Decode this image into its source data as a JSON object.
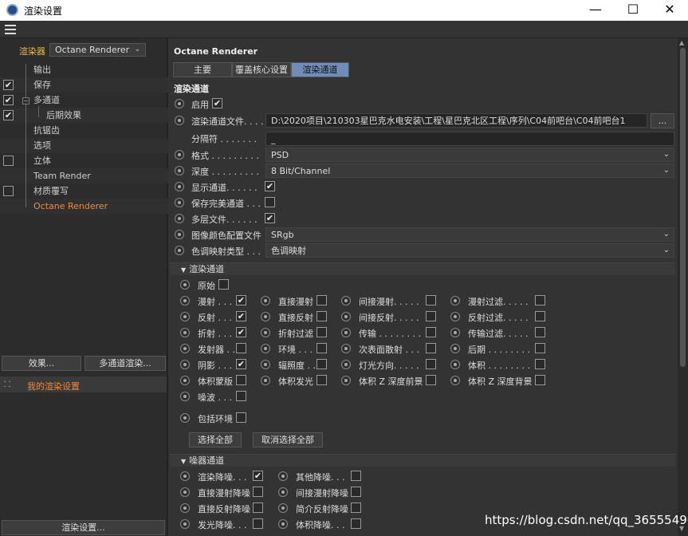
{
  "window": {
    "title": "渲染设置",
    "minimize": "—",
    "maximize": "☐",
    "close": "✕"
  },
  "left": {
    "renderer_label": "渲染器",
    "renderer_value": "Octane Renderer",
    "tree": [
      {
        "label": "输出",
        "checkbox": false,
        "checked": false
      },
      {
        "label": "保存",
        "checkbox": true,
        "checked": true
      },
      {
        "label": "多通道",
        "checkbox": true,
        "checked": true
      },
      {
        "label": "后期效果",
        "checkbox": true,
        "checked": true
      },
      {
        "label": "抗锯齿",
        "checkbox": false,
        "checked": false
      },
      {
        "label": "选项",
        "checkbox": false,
        "checked": false
      },
      {
        "label": "立体",
        "checkbox": true,
        "checked": false
      },
      {
        "label": "Team Render",
        "checkbox": false,
        "checked": false
      },
      {
        "label": "材质覆写",
        "checkbox": true,
        "checked": false
      },
      {
        "label": "Octane Renderer",
        "checkbox": false,
        "checked": false
      }
    ],
    "effects_button": "效果...",
    "multipass_button": "多通道渲染...",
    "preset_label": "我的渲染设置",
    "render_settings_button": "渲染设置..."
  },
  "main": {
    "title": "Octane Renderer",
    "tabs": [
      "主要",
      "覆盖核心设置",
      "渲染通道"
    ],
    "active_tab": 2,
    "section_title": "渲染通道",
    "enable_label": "启用",
    "file_label": "渲染通道文件. . . .",
    "file_value": "D:\\2020项目\\210303星巴克水电安装\\工程\\星巴克北区工程\\序列\\C04前吧台\\C04前吧台1",
    "file_button": "...",
    "separator_label": "分隔符 . . . . . . .",
    "separator_value": "_",
    "format_label": "格式 . . . . . . . . .",
    "format_value": "PSD",
    "depth_label": "深度 . . . . . . . . .",
    "depth_value": "8 Bit/Channel",
    "show_pass_label": "显示通道. . . . . .",
    "save_beauty_label": "保存完美通道 . . .",
    "multilayer_label": "多层文件. . . . . .",
    "color_profile_label": "图像颜色配置文件",
    "color_profile_value": "SRgb",
    "tonemap_label": "色调映射类型 . . .",
    "tonemap_value": "色调映射",
    "passes_header": "渲染通道",
    "raw_label": "原始",
    "pass_rows": [
      [
        {
          "label": "漫射 . . .",
          "checked": true
        },
        {
          "label": "直接漫射",
          "checked": false
        },
        {
          "label": "间接漫射. . . . .",
          "checked": false
        },
        {
          "label": "漫射过滤. . . . .",
          "checked": false
        }
      ],
      [
        {
          "label": "反射 . . .",
          "checked": true
        },
        {
          "label": "直接反射",
          "checked": false
        },
        {
          "label": "间接反射. . . . .",
          "checked": false
        },
        {
          "label": "反射过滤. . . . .",
          "checked": false
        }
      ],
      [
        {
          "label": "折射 . . .",
          "checked": true
        },
        {
          "label": "折射过滤",
          "checked": false
        },
        {
          "label": "传输 . . . . . . . .",
          "checked": false
        },
        {
          "label": "传输过滤. . . . .",
          "checked": false
        }
      ],
      [
        {
          "label": "发射器 . .",
          "checked": false
        },
        {
          "label": "环境 . . .",
          "checked": false
        },
        {
          "label": "次表面散射 . . .",
          "checked": false
        },
        {
          "label": "后期 . . . . . . . .",
          "checked": false
        }
      ],
      [
        {
          "label": "阴影 . . .",
          "checked": true
        },
        {
          "label": "辐照度 . .",
          "checked": false
        },
        {
          "label": "灯光方向. . . . .",
          "checked": false
        },
        {
          "label": "体积 . . . . . . . .",
          "checked": false
        }
      ],
      [
        {
          "label": "体积蒙版",
          "checked": false
        },
        {
          "label": "体积发光",
          "checked": false
        },
        {
          "label": "体积 Z 深度前景",
          "checked": false
        },
        {
          "label": "体积 Z 深度背景",
          "checked": false
        }
      ]
    ],
    "noise_label": "噪波 . . .",
    "include_env_label": "包括环境",
    "select_all": "选择全部",
    "deselect_all": "取消选择全部",
    "denoise_header": "噪器通道",
    "denoise_rows": [
      [
        {
          "label": "渲染降噪. . .",
          "checked": true
        },
        {
          "label": "其他降噪. . .",
          "checked": false
        }
      ],
      [
        {
          "label": "直接漫射降噪",
          "checked": false
        },
        {
          "label": "间接漫射降噪",
          "checked": false
        }
      ],
      [
        {
          "label": "直接反射降噪",
          "checked": false
        },
        {
          "label": "简介反射降噪",
          "checked": false
        }
      ],
      [
        {
          "label": "发光降噪. . .",
          "checked": false
        },
        {
          "label": "体积降噪. . .",
          "checked": false
        }
      ]
    ]
  },
  "watermark": "https://blog.csdn.net/qq_36555496",
  "colors": {
    "active_item": "#f0883a",
    "renderer_label": "#e8b84a",
    "active_tab": "#6e8eb8"
  }
}
